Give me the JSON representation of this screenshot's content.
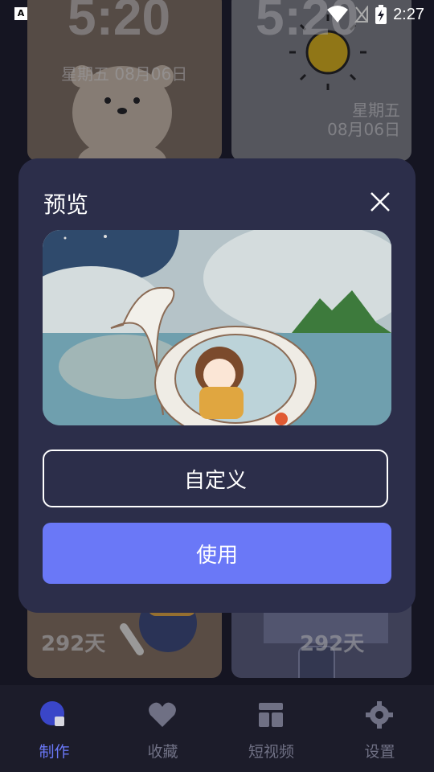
{
  "status_bar": {
    "time": "2:27",
    "app_badge": "A"
  },
  "background_cards": {
    "top_left": {
      "clock": "5:20",
      "date": "星期五 08月06日"
    },
    "top_right": {
      "clock": "5:20",
      "weekday": "星期五",
      "date": "08月06日"
    },
    "bottom_left": {
      "days": "292天"
    },
    "bottom_right": {
      "days": "292天"
    }
  },
  "dialog": {
    "title": "预览",
    "customize_label": "自定义",
    "use_label": "使用"
  },
  "nav": {
    "items": [
      {
        "label": "制作",
        "icon": "make-icon",
        "active": true
      },
      {
        "label": "收藏",
        "icon": "heart-icon",
        "active": false
      },
      {
        "label": "短视频",
        "icon": "layout-icon",
        "active": false
      },
      {
        "label": "设置",
        "icon": "gear-icon",
        "active": false
      }
    ]
  },
  "colors": {
    "accent": "#6a78f7",
    "dialog_bg": "#2c2e4a",
    "page_bg": "#1c1c2a"
  }
}
